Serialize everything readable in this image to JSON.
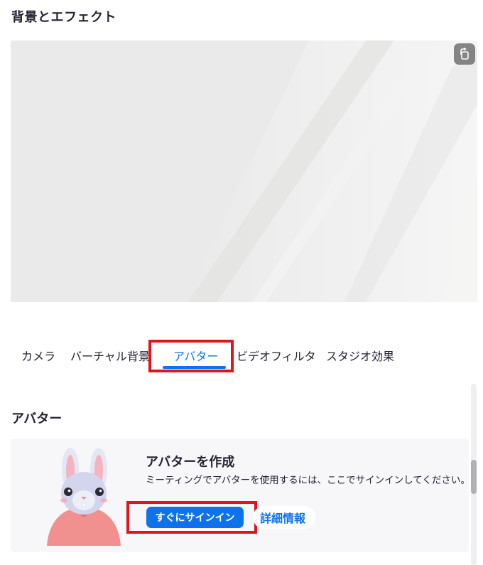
{
  "header": {
    "title": "背景とエフェクト"
  },
  "preview": {
    "rotate_icon": "rotate-camera-icon"
  },
  "tabs": [
    {
      "label": "カメラ"
    },
    {
      "label": "バーチャル背景"
    },
    {
      "label": "アバター",
      "active": true
    },
    {
      "label": "ビデオフィルタ"
    },
    {
      "label": "スタジオ効果"
    }
  ],
  "section": {
    "title": "アバター"
  },
  "avatar_card": {
    "title": "アバターを作成",
    "description": "ミーティングでアバターを使用するには、ここでサインインしてください。",
    "signin_label": "すぐにサインイン",
    "more_info_label": "詳細情報",
    "illustration": "bunny-avatar-illustration"
  },
  "colors": {
    "accent": "#0e72ed",
    "highlight": "#e0151b",
    "card_bg": "#f7f7fa"
  }
}
